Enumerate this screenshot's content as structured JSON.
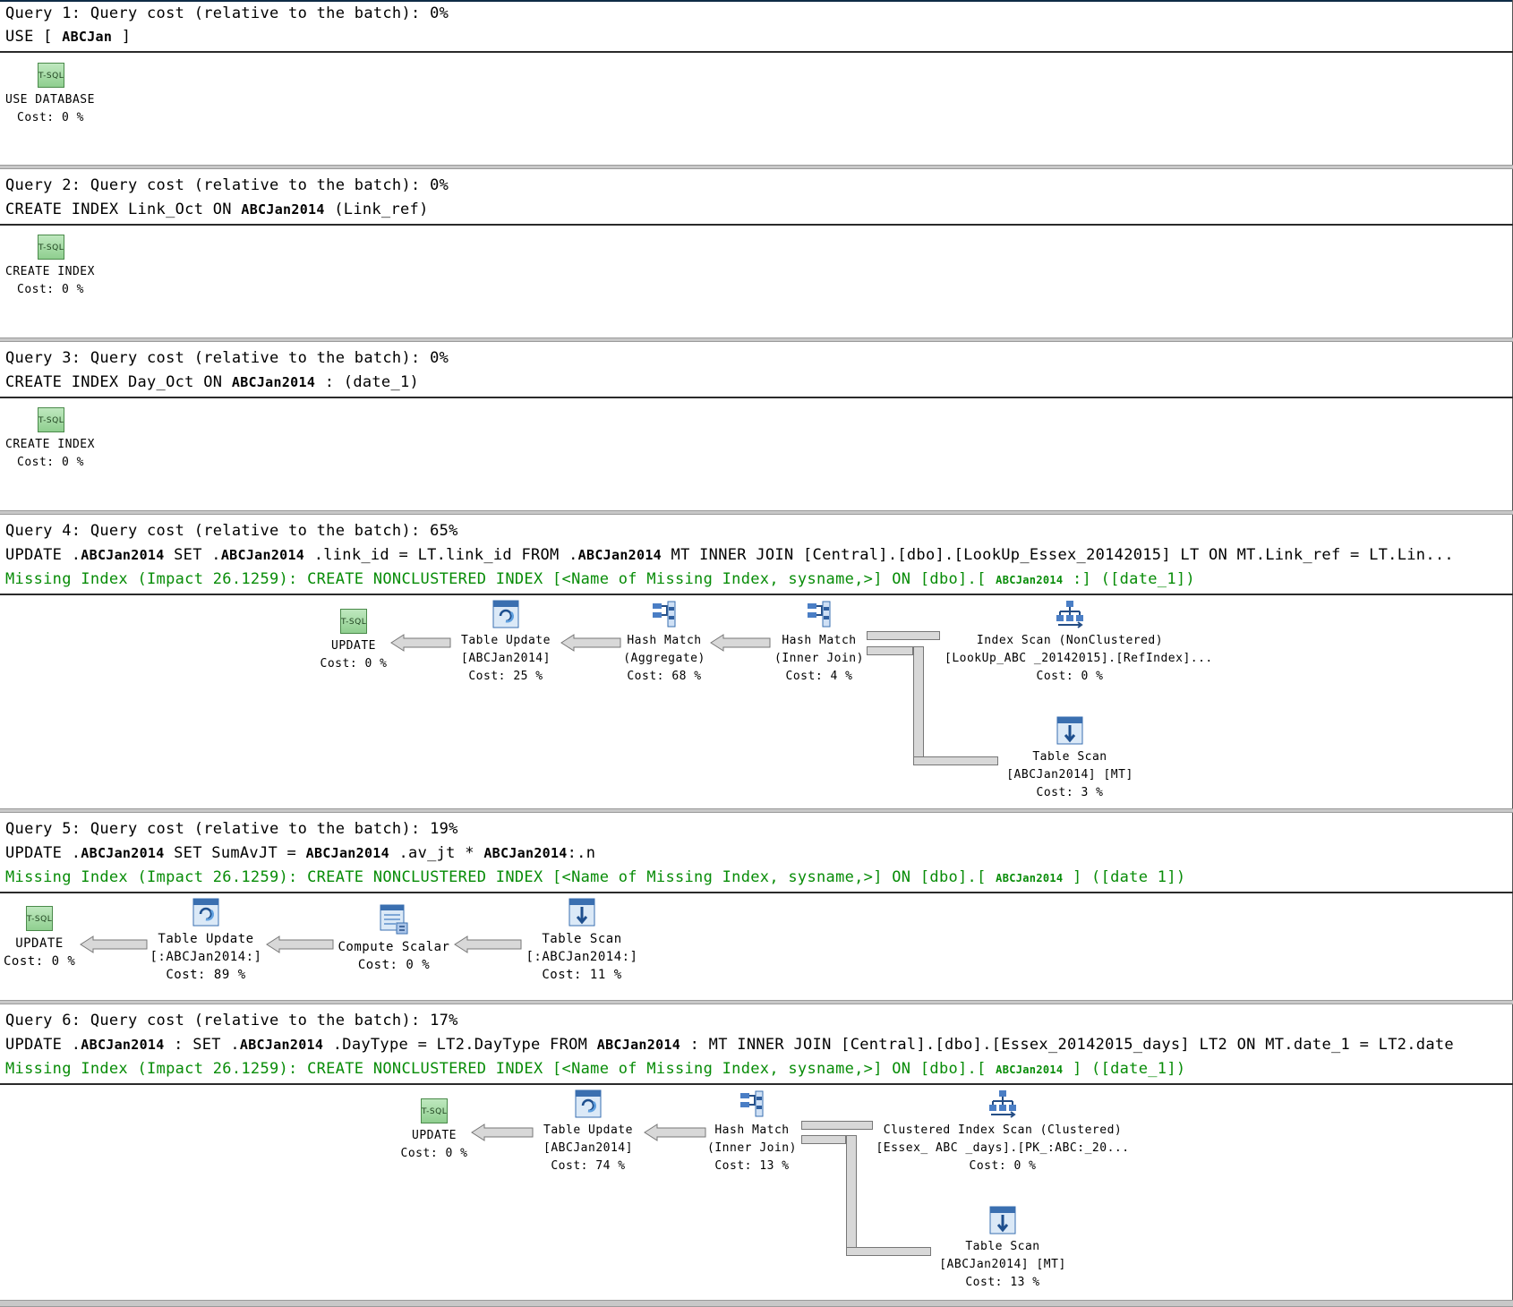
{
  "queries": [
    {
      "header": "Query 1: Query cost (relative to the batch): 0%",
      "sql": {
        "pre": "USE [",
        "b1": "ABCJan",
        "post": "]"
      },
      "node": {
        "op": "USE DATABASE",
        "cost": "Cost: 0 %"
      }
    },
    {
      "header": "Query 2: Query cost (relative to the batch): 0%",
      "sql": {
        "pre": "CREATE INDEX Link_Oct ON",
        "b1": "ABCJan2014",
        "post": "(Link_ref)"
      },
      "node": {
        "op": "CREATE INDEX",
        "cost": "Cost: 0 %"
      }
    },
    {
      "header": "Query 3: Query cost (relative to the batch): 0%",
      "sql": {
        "pre": "CREATE INDEX Day_Oct ON",
        "b1": "ABCJan2014",
        "post": ": (date_1)"
      },
      "node": {
        "op": "CREATE INDEX",
        "cost": "Cost: 0 %"
      }
    },
    {
      "header": "Query 4: Query cost (relative to the batch): 65%",
      "sql": {
        "p1": "UPDATE .",
        "b1": "ABCJan2014",
        "p2": "SET .",
        "b2": "ABCJan2014",
        "p3": ".link_id = LT.link_id FROM .",
        "b3": "ABCJan2014",
        "p4": "MT INNER JOIN [Central].[dbo].[LookUp_Essex_20142015] LT ON MT.Link_ref = LT.Lin..."
      },
      "missing": {
        "pre": "Missing Index (Impact 26.1259): CREATE NONCLUSTERED INDEX [<Name of Missing Index, sysname,>] ON [dbo].[",
        "b": "ABCJan2014",
        "post": ":] ([date_1])"
      },
      "nodes": [
        {
          "name": "UPDATE",
          "obj": "",
          "cost": "Cost: 0 %"
        },
        {
          "name": "Table Update",
          "obj": "[ABCJan2014]",
          "cost": "Cost: 25 %"
        },
        {
          "name": "Hash Match",
          "obj": "(Aggregate)",
          "cost": "Cost: 68 %"
        },
        {
          "name": "Hash Match",
          "obj": "(Inner Join)",
          "cost": "Cost: 4 %"
        },
        {
          "name": "Index Scan (NonClustered)",
          "obj": "[LookUp_ABC _20142015].[RefIndex]...",
          "cost": "Cost: 0 %"
        },
        {
          "name": "Table Scan",
          "obj": "[ABCJan2014] [MT]",
          "cost": "Cost: 3 %"
        }
      ]
    },
    {
      "header": "Query 5: Query cost (relative to the batch): 19%",
      "sql": {
        "p1": "UPDATE .",
        "b1": "ABCJan2014",
        "p2": "SET SumAvJT =",
        "b2": "ABCJan2014",
        "p3": ".av_jt *",
        "b3": "ABCJan2014",
        "p4": ":.n"
      },
      "missing": {
        "pre": "Missing Index (Impact 26.1259): CREATE NONCLUSTERED INDEX [<Name of Missing Index, sysname,>] ON [dbo].[",
        "b": "ABCJan2014",
        "post": "] ([date 1])"
      },
      "nodes": [
        {
          "name": "UPDATE",
          "obj": "",
          "cost": "Cost: 0 %"
        },
        {
          "name": "Table Update",
          "obj": "[:ABCJan2014:]",
          "cost": "Cost: 89 %"
        },
        {
          "name": "Compute Scalar",
          "obj": "",
          "cost": "Cost: 0 %"
        },
        {
          "name": "Table Scan",
          "obj": "[:ABCJan2014:]",
          "cost": "Cost: 11 %"
        }
      ]
    },
    {
      "header": "Query 6: Query cost (relative to the batch): 17%",
      "sql": {
        "p1": "UPDATE .",
        "b1": "ABCJan2014",
        "p2": ": SET .",
        "b2": "ABCJan2014",
        "p3": ".DayType = LT2.DayType FROM",
        "b3": "ABCJan2014",
        "p4": ": MT INNER JOIN [Central].[dbo].[Essex_20142015_days] LT2 ON MT.date_1 = LT2.date"
      },
      "missing": {
        "pre": "Missing Index (Impact 26.1259): CREATE NONCLUSTERED INDEX [<Name of Missing Index, sysname,>] ON [dbo].[",
        "b": "ABCJan2014",
        "post": "] ([date_1])"
      },
      "nodes": [
        {
          "name": "UPDATE",
          "obj": "",
          "cost": "Cost: 0 %"
        },
        {
          "name": "Table Update",
          "obj": "[ABCJan2014]",
          "cost": "Cost: 74 %"
        },
        {
          "name": "Hash Match",
          "obj": "(Inner Join)",
          "cost": "Cost: 13 %"
        },
        {
          "name": "Clustered Index Scan (Clustered)",
          "obj": "[Essex_ ABC _days].[PK_:ABC:_20...",
          "cost": "Cost: 0 %"
        },
        {
          "name": "Table Scan",
          "obj": "[ABCJan2014] [MT]",
          "cost": "Cost: 13 %"
        }
      ]
    }
  ],
  "icons": {
    "tsql": "T-SQL",
    "table-update": "table-update-icon",
    "hash-match": "hash-match-icon",
    "index-scan": "index-scan-icon",
    "table-scan": "table-scan-icon",
    "compute-scalar": "compute-scalar-icon"
  },
  "colors": {
    "missing_index_text": "#078c07",
    "divider": "#2a2a2a",
    "pipe": "#d8d8d8"
  }
}
